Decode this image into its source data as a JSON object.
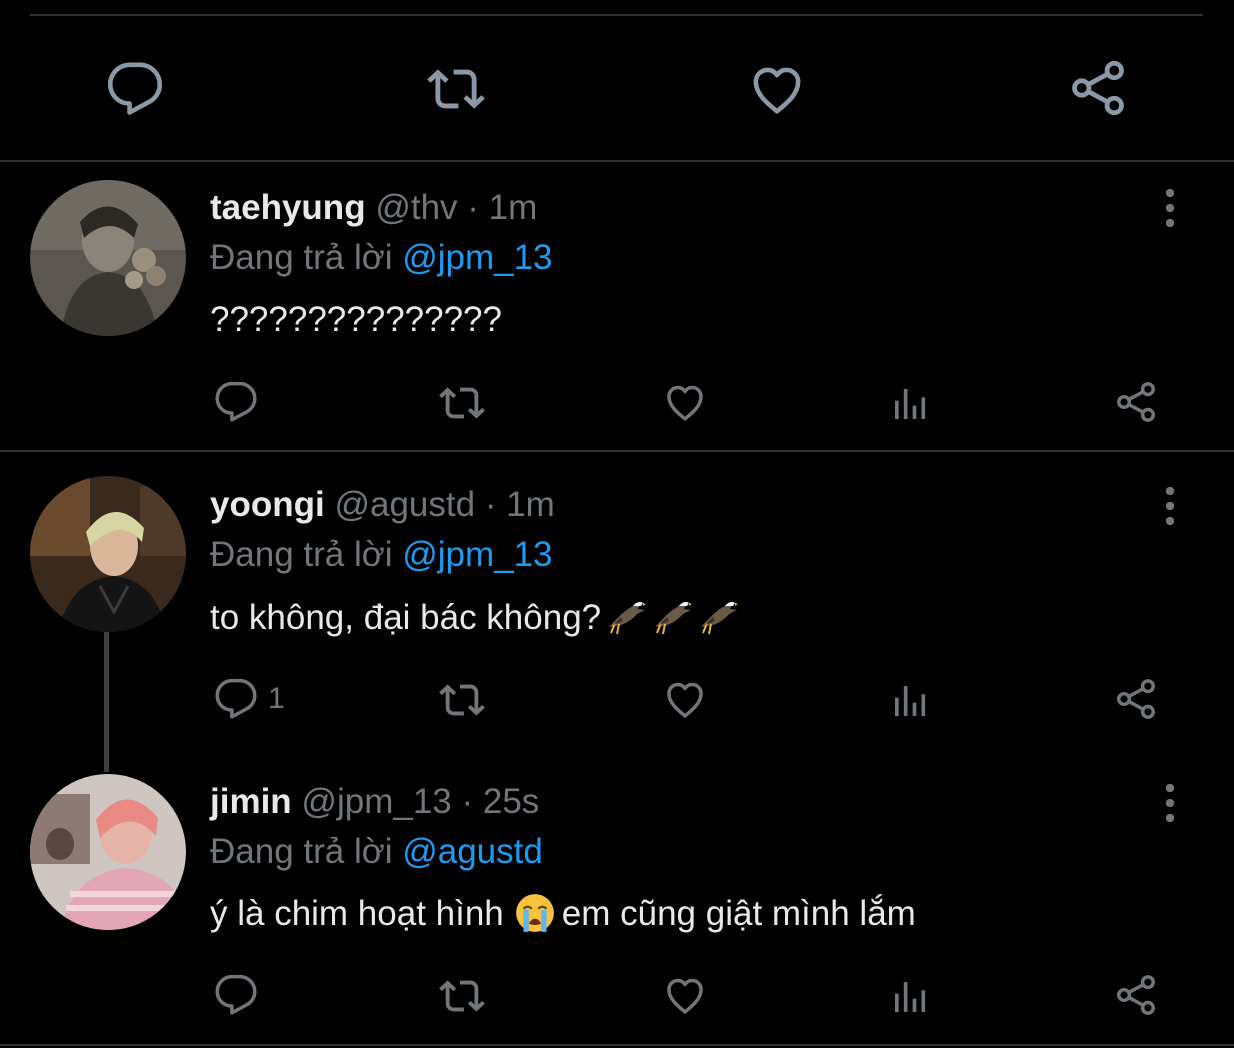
{
  "colors": {
    "background": "#000000",
    "divider": "#2f3336",
    "primary_text": "#e7e9ea",
    "secondary_text": "#71767b",
    "mention": "#1d9bf0",
    "icon": "#71767b",
    "focus_icon": "#8b98a5"
  },
  "focused_tweet_actions": {
    "icons": [
      "reply-icon",
      "retweet-icon",
      "like-icon",
      "share-icon"
    ]
  },
  "replies": [
    {
      "display_name": "taehyung",
      "handle": "@thv",
      "separator": "·",
      "time": "1m",
      "replying_label": "Đang trả lời",
      "replying_to": "@jpm_13",
      "text": "???????????????",
      "reply_count": "",
      "avatar": "avatar-taehyung"
    },
    {
      "display_name": "yoongi",
      "handle": "@agustd",
      "separator": "·",
      "time": "1m",
      "replying_label": "Đang trả lời",
      "replying_to": "@jpm_13",
      "text": "to không, đại bác không?",
      "emoji": "eagle-emoji",
      "reply_count": "1",
      "avatar": "avatar-yoongi"
    },
    {
      "display_name": "jimin",
      "handle": "@jpm_13",
      "separator": "·",
      "time": "25s",
      "replying_label": "Đang trả lời",
      "replying_to": "@agustd",
      "text_before": "ý là chim hoạt hình",
      "emoji": "loudly-crying-face-emoji",
      "text_after": "em cũng giật mình lắm",
      "reply_count": "",
      "avatar": "avatar-jimin"
    }
  ]
}
